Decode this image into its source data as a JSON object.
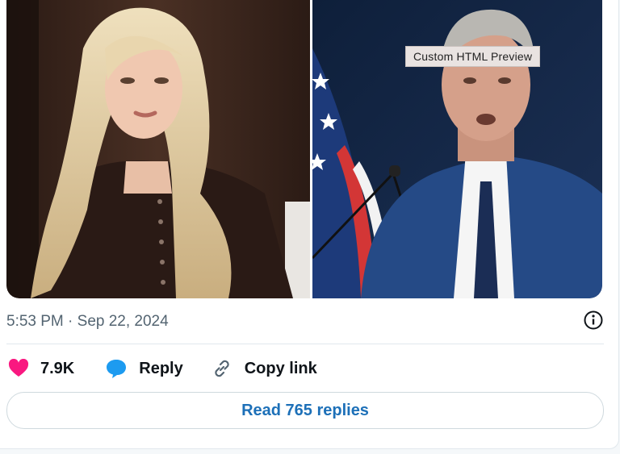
{
  "overlay": {
    "label": "Custom HTML Preview"
  },
  "tweet": {
    "timestamp": "5:53 PM · Sep 22, 2024",
    "likes": "7.9K",
    "reply_label": "Reply",
    "copy_link_label": "Copy link",
    "read_replies_label": "Read 765 replies"
  },
  "icons": {
    "info": "info-icon",
    "like": "heart-icon",
    "reply": "speech-bubble-icon",
    "copy": "link-icon"
  },
  "colors": {
    "heart": "#f91880",
    "reply_bubble": "#1d9bf0",
    "replies_text": "#1d70b8",
    "muted_text": "#536471"
  }
}
